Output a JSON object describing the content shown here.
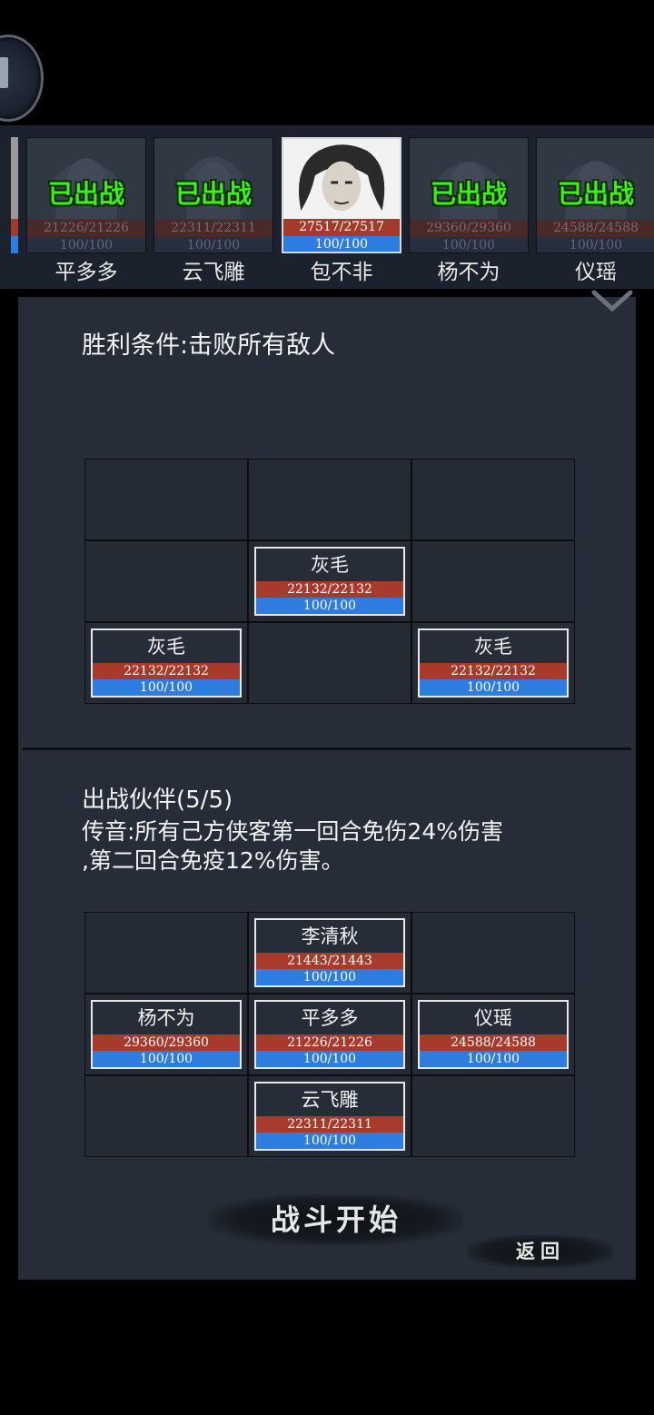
{
  "roster": {
    "cards": [
      {
        "name": "平多多",
        "hp": "21226/21226",
        "mp": "100/100",
        "status": "已出战",
        "used": true
      },
      {
        "name": "云飞雕",
        "hp": "22311/22311",
        "mp": "100/100",
        "status": "已出战",
        "used": true
      },
      {
        "name": "包不非",
        "hp": "27517/27517",
        "mp": "100/100",
        "status": "",
        "used": false
      },
      {
        "name": "杨不为",
        "hp": "29360/29360",
        "mp": "100/100",
        "status": "已出战",
        "used": true
      },
      {
        "name": "仪瑶",
        "hp": "24588/24588",
        "mp": "100/100",
        "status": "已出战",
        "used": true
      }
    ]
  },
  "victory_condition": "胜利条件:击败所有敌人",
  "enemy_grid": [
    {
      "name": "灰毛",
      "hp": "22132/22132",
      "mp": "100/100"
    },
    {
      "name": "灰毛",
      "hp": "22132/22132",
      "mp": "100/100"
    },
    {
      "name": "灰毛",
      "hp": "22132/22132",
      "mp": "100/100"
    }
  ],
  "partners": {
    "title": "出战伙伴(5/5)",
    "buff_line1": "传音:所有己方侠客第一回合免伤24%伤害",
    "buff_line2": ",第二回合免疫12%伤害。",
    "units": [
      {
        "name": "李清秋",
        "hp": "21443/21443",
        "mp": "100/100"
      },
      {
        "name": "杨不为",
        "hp": "29360/29360",
        "mp": "100/100"
      },
      {
        "name": "平多多",
        "hp": "21226/21226",
        "mp": "100/100"
      },
      {
        "name": "仪瑶",
        "hp": "24588/24588",
        "mp": "100/100"
      },
      {
        "name": "云飞雕",
        "hp": "22311/22311",
        "mp": "100/100"
      }
    ]
  },
  "buttons": {
    "start": "战斗开始",
    "back": "返回"
  },
  "colors": {
    "hp_bar": "#a83a2b",
    "mp_bar": "#2d7de0",
    "deployed_text": "#3cf018",
    "panel": "#262d38"
  }
}
